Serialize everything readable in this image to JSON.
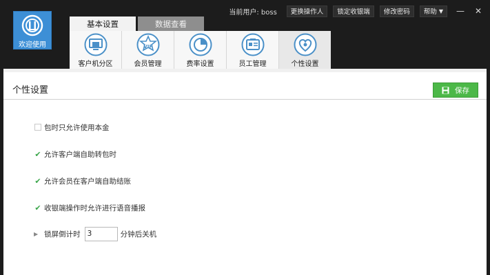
{
  "app": {
    "logo_text": "欢迎使用"
  },
  "topbar": {
    "current_user": "当前用户: boss",
    "buttons": [
      "更换操作人",
      "锁定收银端",
      "修改密码"
    ],
    "help_label": "帮助",
    "minimize_label": "—",
    "close_label": "✕"
  },
  "tabs": [
    {
      "label": "基本设置",
      "active": true
    },
    {
      "label": "数据查看",
      "active": false
    }
  ],
  "toolbar": {
    "items": [
      {
        "label": "客户机分区",
        "icon": "monitor-icon"
      },
      {
        "label": "会员管理",
        "icon": "vip-star-icon"
      },
      {
        "label": "费率设置",
        "icon": "pie-chart-icon"
      },
      {
        "label": "员工管理",
        "icon": "id-card-icon"
      },
      {
        "label": "个性设置",
        "icon": "heart-gear-icon",
        "active": true
      }
    ]
  },
  "panel": {
    "title": "个性设置",
    "save_label": "保存",
    "options": [
      {
        "label": "包时只允许使用本金",
        "checked": false
      },
      {
        "label": "允许客户端自助转包时",
        "checked": true
      },
      {
        "label": "允许会员在客户端自助结账",
        "checked": true
      },
      {
        "label": "收银端操作时允许进行语音播报",
        "checked": true
      }
    ],
    "lock": {
      "label": "锁屏倒计时",
      "value": "3",
      "suffix": "分钟后关机"
    }
  },
  "colors": {
    "accent_blue": "#3d8fd6",
    "save_green": "#4cb848",
    "check_green": "#3aa64a",
    "dark_bg": "#1c1c1c"
  }
}
